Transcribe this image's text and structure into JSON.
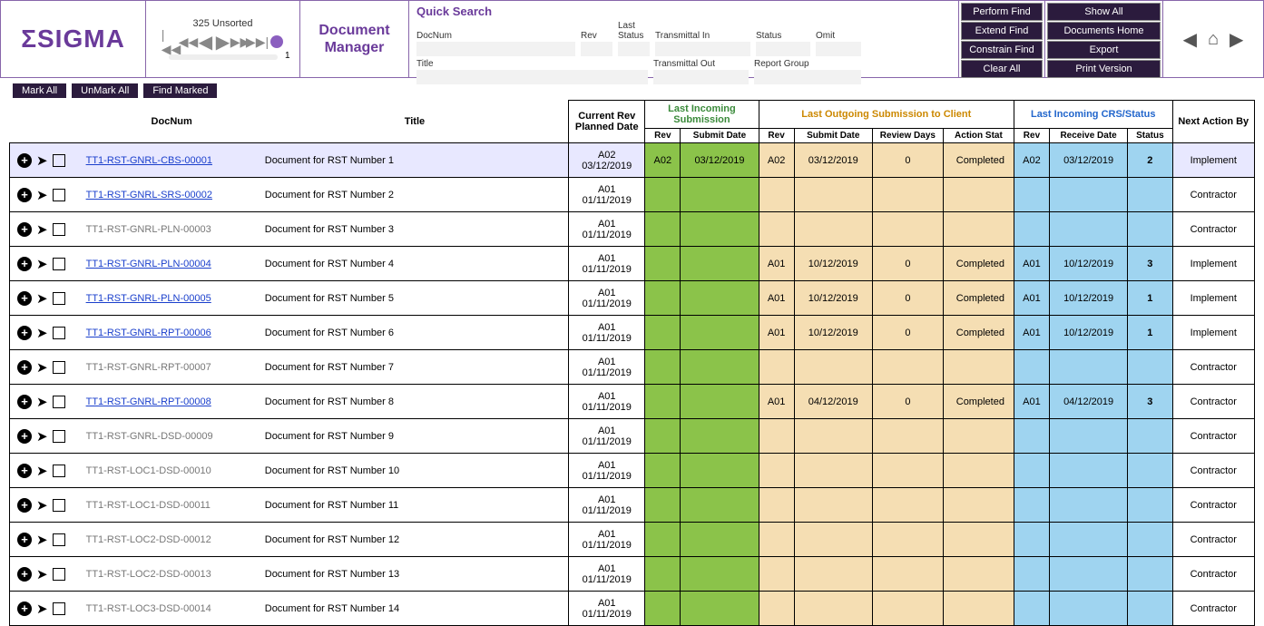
{
  "logo": "ΣSIGMA",
  "unsorted": "325 Unsorted",
  "slider_pos": "1",
  "dm_line1": "Document",
  "dm_line2": "Manager",
  "qs_title": "Quick Search",
  "labels": {
    "docnum": "DocNum",
    "rev": "Rev",
    "laststatus": "Last Status",
    "tin": "Transmittal In",
    "status": "Status",
    "omit": "Omit",
    "title": "Title",
    "tout": "Transmittal Out",
    "rgroup": "Report Group"
  },
  "btns1": [
    "Perform Find",
    "Extend Find",
    "Constrain Find",
    "Clear All"
  ],
  "btns2": [
    "Show All",
    "Documents Home",
    "Export",
    "Print Version"
  ],
  "marks": [
    "Mark All",
    "UnMark All",
    "Find Marked"
  ],
  "hdrs": {
    "docnum": "DocNum",
    "title": "Title",
    "plan": "Current Rev Planned Date",
    "in": "Last Incoming Submission",
    "out": "Last Outgoing Submission to Client",
    "crs": "Last Incoming CRS/Status",
    "next": "Next Action By",
    "rev": "Rev",
    "submit": "Submit Date",
    "review": "Review Days",
    "astat": "Action Stat",
    "receive": "Receive Date",
    "status": "Status"
  },
  "rows": [
    {
      "sel": true,
      "link": true,
      "doc": "TT1-RST-GNRL-CBS-00001",
      "title": "Document for RST Number 1",
      "plan_rev": "A02",
      "plan_date": "03/12/2019",
      "in_rev": "A02",
      "in_date": "03/12/2019",
      "out_rev": "A02",
      "out_date": "03/12/2019",
      "out_days": "0",
      "out_stat": "Completed",
      "crs_rev": "A02",
      "crs_date": "03/12/2019",
      "crs_st": "2",
      "next": "Implement"
    },
    {
      "link": true,
      "doc": "TT1-RST-GNRL-SRS-00002",
      "title": "Document for RST Number 2",
      "plan_rev": "A01",
      "plan_date": "01/11/2019",
      "next": "Contractor"
    },
    {
      "link": false,
      "doc": "TT1-RST-GNRL-PLN-00003",
      "title": "Document for RST Number 3",
      "plan_rev": "A01",
      "plan_date": "01/11/2019",
      "next": "Contractor"
    },
    {
      "link": true,
      "doc": "TT1-RST-GNRL-PLN-00004",
      "title": "Document for RST Number 4",
      "plan_rev": "A01",
      "plan_date": "01/11/2019",
      "out_rev": "A01",
      "out_date": "10/12/2019",
      "out_days": "0",
      "out_stat": "Completed",
      "crs_rev": "A01",
      "crs_date": "10/12/2019",
      "crs_st": "3",
      "next": "Implement"
    },
    {
      "link": true,
      "doc": "TT1-RST-GNRL-PLN-00005",
      "title": "Document for RST Number 5",
      "plan_rev": "A01",
      "plan_date": "01/11/2019",
      "out_rev": "A01",
      "out_date": "10/12/2019",
      "out_days": "0",
      "out_stat": "Completed",
      "crs_rev": "A01",
      "crs_date": "10/12/2019",
      "crs_st": "1",
      "next": "Implement"
    },
    {
      "link": true,
      "doc": "TT1-RST-GNRL-RPT-00006",
      "title": "Document for RST Number 6",
      "plan_rev": "A01",
      "plan_date": "01/11/2019",
      "out_rev": "A01",
      "out_date": "10/12/2019",
      "out_days": "0",
      "out_stat": "Completed",
      "crs_rev": "A01",
      "crs_date": "10/12/2019",
      "crs_st": "1",
      "next": "Implement"
    },
    {
      "link": false,
      "doc": "TT1-RST-GNRL-RPT-00007",
      "title": "Document for RST Number 7",
      "plan_rev": "A01",
      "plan_date": "01/11/2019",
      "next": "Contractor"
    },
    {
      "link": true,
      "doc": "TT1-RST-GNRL-RPT-00008",
      "title": "Document for RST Number 8",
      "plan_rev": "A01",
      "plan_date": "01/11/2019",
      "out_rev": "A01",
      "out_date": "04/12/2019",
      "out_days": "0",
      "out_stat": "Completed",
      "crs_rev": "A01",
      "crs_date": "04/12/2019",
      "crs_st": "3",
      "next": "Contractor"
    },
    {
      "link": false,
      "doc": "TT1-RST-GNRL-DSD-00009",
      "title": "Document for RST Number 9",
      "plan_rev": "A01",
      "plan_date": "01/11/2019",
      "next": "Contractor"
    },
    {
      "link": false,
      "doc": "TT1-RST-LOC1-DSD-00010",
      "title": "Document for RST Number 10",
      "plan_rev": "A01",
      "plan_date": "01/11/2019",
      "next": "Contractor"
    },
    {
      "link": false,
      "doc": "TT1-RST-LOC1-DSD-00011",
      "title": "Document for RST Number 11",
      "plan_rev": "A01",
      "plan_date": "01/11/2019",
      "next": "Contractor"
    },
    {
      "link": false,
      "doc": "TT1-RST-LOC2-DSD-00012",
      "title": "Document for RST Number 12",
      "plan_rev": "A01",
      "plan_date": "01/11/2019",
      "next": "Contractor"
    },
    {
      "link": false,
      "doc": "TT1-RST-LOC2-DSD-00013",
      "title": "Document for RST Number 13",
      "plan_rev": "A01",
      "plan_date": "01/11/2019",
      "next": "Contractor"
    },
    {
      "link": false,
      "doc": "TT1-RST-LOC3-DSD-00014",
      "title": "Document for RST Number 14",
      "plan_rev": "A01",
      "plan_date": "01/11/2019",
      "next": "Contractor"
    }
  ]
}
